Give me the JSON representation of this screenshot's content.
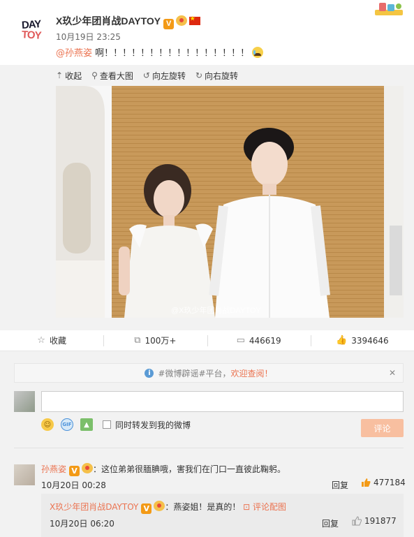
{
  "post": {
    "author": "X玖少年团肖战DAYTOY",
    "avatar_text_top": "DAY",
    "avatar_text_bottom": "TOY",
    "badge": "V",
    "time": "10月19日 23:25",
    "mention": "@孙燕姿",
    "text": " 啊！！！！！！！！！！！！！！！！"
  },
  "media_toolbar": {
    "collapse": "收起",
    "view_large": "查看大图",
    "rotate_left": "向左旋转",
    "rotate_right": "向右旋转"
  },
  "photo": {
    "watermark": "@X玖少年团肖战DAYTOY"
  },
  "actions": {
    "favorite": "收藏",
    "repost": "100万+",
    "comment": "446619",
    "like": "3394646"
  },
  "notice": {
    "text": "#微博辟谣#平台，",
    "link": "欢迎查阅！",
    "close": "✕"
  },
  "composer": {
    "checkbox_label": "同时转发到我的微博",
    "submit": "评论",
    "gif_label": "GIF"
  },
  "comment": {
    "author": "孙燕姿",
    "text": "：这位弟弟很腼腆哦，害我们在门口一直彼此鞠躬。",
    "time": "10月20日 00:28",
    "reply": "回复",
    "likes": "477184"
  },
  "subreply": {
    "author": "X玖少年团肖战DAYTOY",
    "text": "：燕姿姐！是真的！",
    "pic_link": "评论配图",
    "time": "10月20日 06:20",
    "reply": "回复",
    "likes": "191877"
  },
  "colors": {
    "accent": "#eb7350",
    "vbadge": "#f39a16",
    "submit_disabled": "#f8bfa0"
  }
}
